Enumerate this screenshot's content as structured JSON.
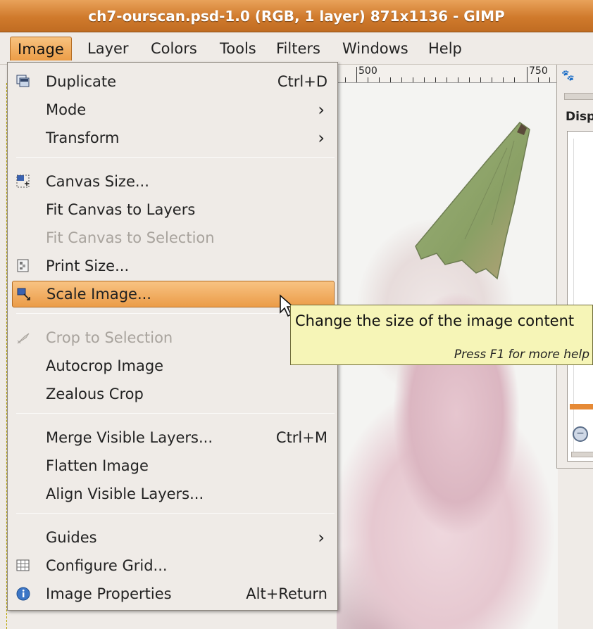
{
  "window": {
    "title": "ch7-ourscan.psd-1.0 (RGB, 1 layer) 871x1136 - GIMP"
  },
  "menubar": {
    "items": [
      {
        "label": "Image"
      },
      {
        "label": "Layer"
      },
      {
        "label": "Colors"
      },
      {
        "label": "Tools"
      },
      {
        "label": "Filters"
      },
      {
        "label": "Windows"
      },
      {
        "label": "Help"
      }
    ]
  },
  "ruler": {
    "labels": [
      "500",
      "750"
    ]
  },
  "dock": {
    "panel_title": "Disp"
  },
  "image_menu": {
    "items": [
      {
        "label": "Duplicate",
        "shortcut": "Ctrl+D",
        "icon": "duplicate-icon"
      },
      {
        "label": "Mode",
        "submenu": true
      },
      {
        "label": "Transform",
        "submenu": true
      },
      {
        "label": "Canvas Size...",
        "icon": "canvas-size-icon"
      },
      {
        "label": "Fit Canvas to Layers"
      },
      {
        "label": "Fit Canvas to Selection",
        "disabled": true
      },
      {
        "label": "Print Size...",
        "icon": "print-size-icon"
      },
      {
        "label": "Scale Image...",
        "icon": "scale-image-icon",
        "highlighted": true
      },
      {
        "label": "Crop to Selection",
        "icon": "crop-icon",
        "disabled": true
      },
      {
        "label": "Autocrop Image"
      },
      {
        "label": "Zealous Crop"
      },
      {
        "label": "Merge Visible Layers...",
        "shortcut": "Ctrl+M"
      },
      {
        "label": "Flatten Image"
      },
      {
        "label": "Align Visible Layers..."
      },
      {
        "label": "Guides",
        "submenu": true
      },
      {
        "label": "Configure Grid...",
        "icon": "grid-icon"
      },
      {
        "label": "Image Properties",
        "shortcut": "Alt+Return",
        "icon": "info-icon"
      }
    ]
  },
  "tooltip": {
    "text": "Change the size of the image content",
    "help": "Press F1 for more help"
  },
  "colors": {
    "highlight": "#eb9c48",
    "titlebar": "#d07a2c",
    "tooltip_bg": "#f6f5b7"
  }
}
